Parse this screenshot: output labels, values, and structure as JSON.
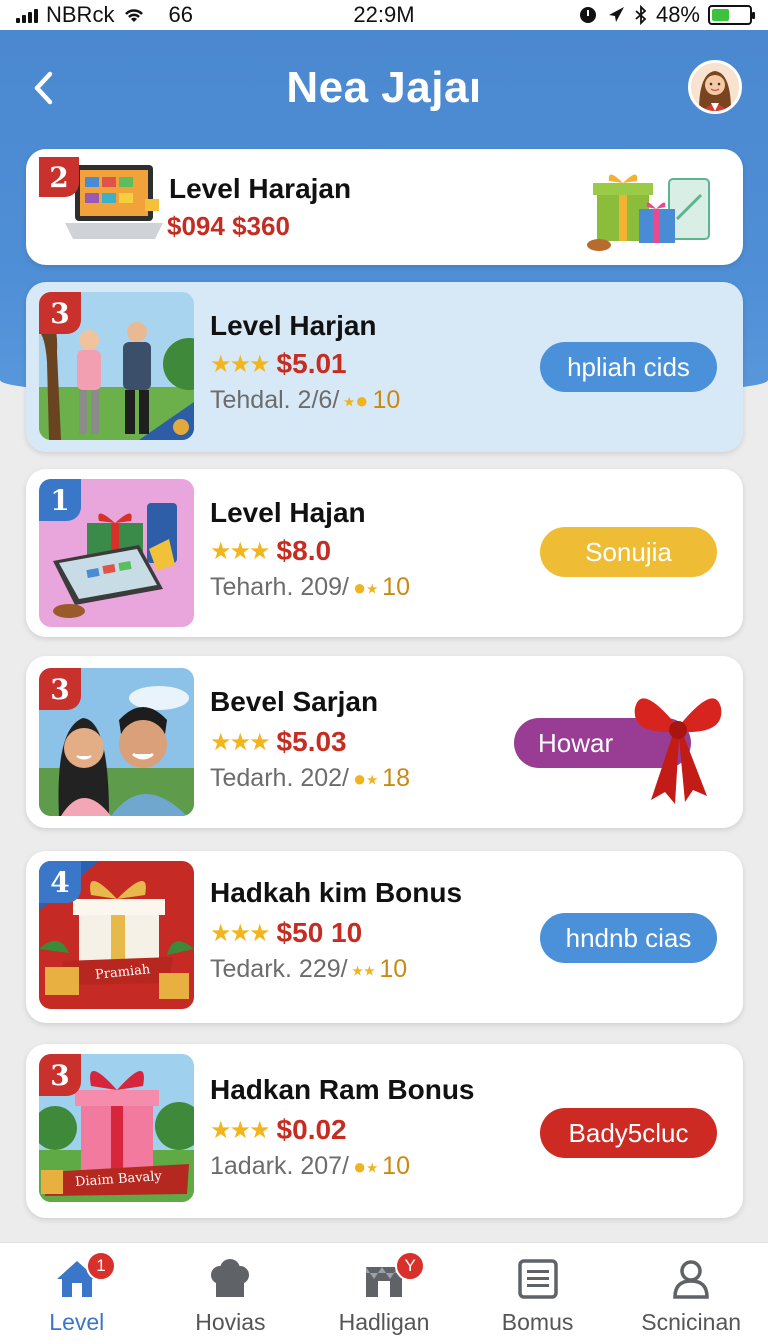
{
  "status_bar": {
    "carrier": "NBRck",
    "network": "66",
    "time": "22:9M",
    "battery": "48%",
    "battery_level": 0.48
  },
  "header": {
    "title": "Nea Jajaı"
  },
  "featured": {
    "rank": "2",
    "title": "Level Harajan",
    "price": "$094 $360"
  },
  "items": [
    {
      "rank": "3",
      "title": "Level Harjan",
      "stars": "★★★",
      "price": "$5.01",
      "meta": "Tehdal. 2/6/",
      "meta_num": "10",
      "button": "hpliah cids"
    },
    {
      "rank": "1",
      "title": "Level Hajan",
      "stars": "★★★",
      "price": "$8.0",
      "meta": "Teharh. 209/",
      "meta_num": "10",
      "button": "Sonujia"
    },
    {
      "rank": "3",
      "title": "Bevel Sarjan",
      "stars": "★★★",
      "price": "$5.03",
      "meta": "Tedarh. 202/",
      "meta_num": "18",
      "button": "Howar"
    },
    {
      "rank": "4",
      "title": "Hadkah kim Bonus",
      "stars": "★★★",
      "price": "$50 10",
      "meta": "Tedark. 229/",
      "meta_num": "10",
      "button": "hndnb cias"
    },
    {
      "rank": "3",
      "title": "Hadkan Ram Bonus",
      "stars": "★★★",
      "price": "$0.02",
      "meta": "1adark. 207/",
      "meta_num": "10",
      "button": "Bady5cluc"
    }
  ],
  "thumb_labels": {
    "item4": "Pramiah",
    "item5": "Diaim Bavaly"
  },
  "nav": [
    {
      "label": "Level",
      "badge": "1"
    },
    {
      "label": "Hovias",
      "badge": ""
    },
    {
      "label": "Hadligan",
      "badge": "Y"
    },
    {
      "label": "Bomus",
      "badge": ""
    },
    {
      "label": "Scnicinan",
      "badge": ""
    }
  ],
  "colors": {
    "header_blue": "#4a87cf",
    "price_red": "#c62d22",
    "star_gold": "#f3b51c",
    "btn_blue": "#4b91d9",
    "btn_yellow": "#efbd35",
    "btn_purple": "#983d93",
    "btn_red": "#cd2a24",
    "nav_active": "#3a77c8"
  }
}
